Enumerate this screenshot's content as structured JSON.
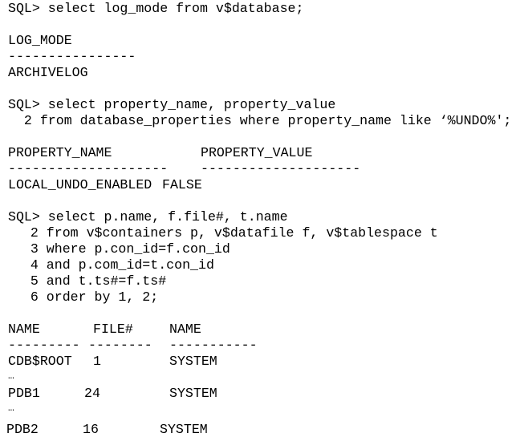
{
  "theme": {
    "background": "#ffffff",
    "text": "#000000"
  },
  "query1": {
    "prompt_line": "SQL> select log_mode from v$database;",
    "result": {
      "header": "LOG_MODE",
      "separator": "----------------",
      "rows": [
        "ARCHIVELOG"
      ]
    }
  },
  "query2": {
    "lines": [
      "SQL> select property_name, property_value",
      "  2 from database_properties where property_name like ‘%UNDO%';"
    ],
    "result": {
      "headers": [
        "PROPERTY_NAME",
        "PROPERTY_VALUE"
      ],
      "separators": [
        "--------------------",
        "--------------------"
      ],
      "rows": [
        [
          "LOCAL_UNDO_ENABLED",
          "FALSE"
        ]
      ]
    }
  },
  "query3": {
    "lines": [
      "SQL> select p.name, f.file#, t.name",
      "   2 from v$containers p, v$datafile f, v$tablespace t",
      "   3 where p.con_id=f.con_id",
      "   4 and p.com_id=t.con_id",
      "   5 and t.ts#=f.ts#",
      "   6 order by 1, 2;"
    ],
    "result": {
      "headers": [
        "NAME",
        "FILE#",
        "NAME"
      ],
      "separators": [
        "---------",
        "--------",
        "-----------"
      ],
      "rows": [
        [
          "CDB$ROOT",
          "1",
          "SYSTEM"
        ],
        [
          "PDB1",
          "24",
          "SYSTEM"
        ],
        [
          "PDB2",
          "16",
          "SYSTEM"
        ]
      ],
      "ellipsis": "…"
    }
  }
}
